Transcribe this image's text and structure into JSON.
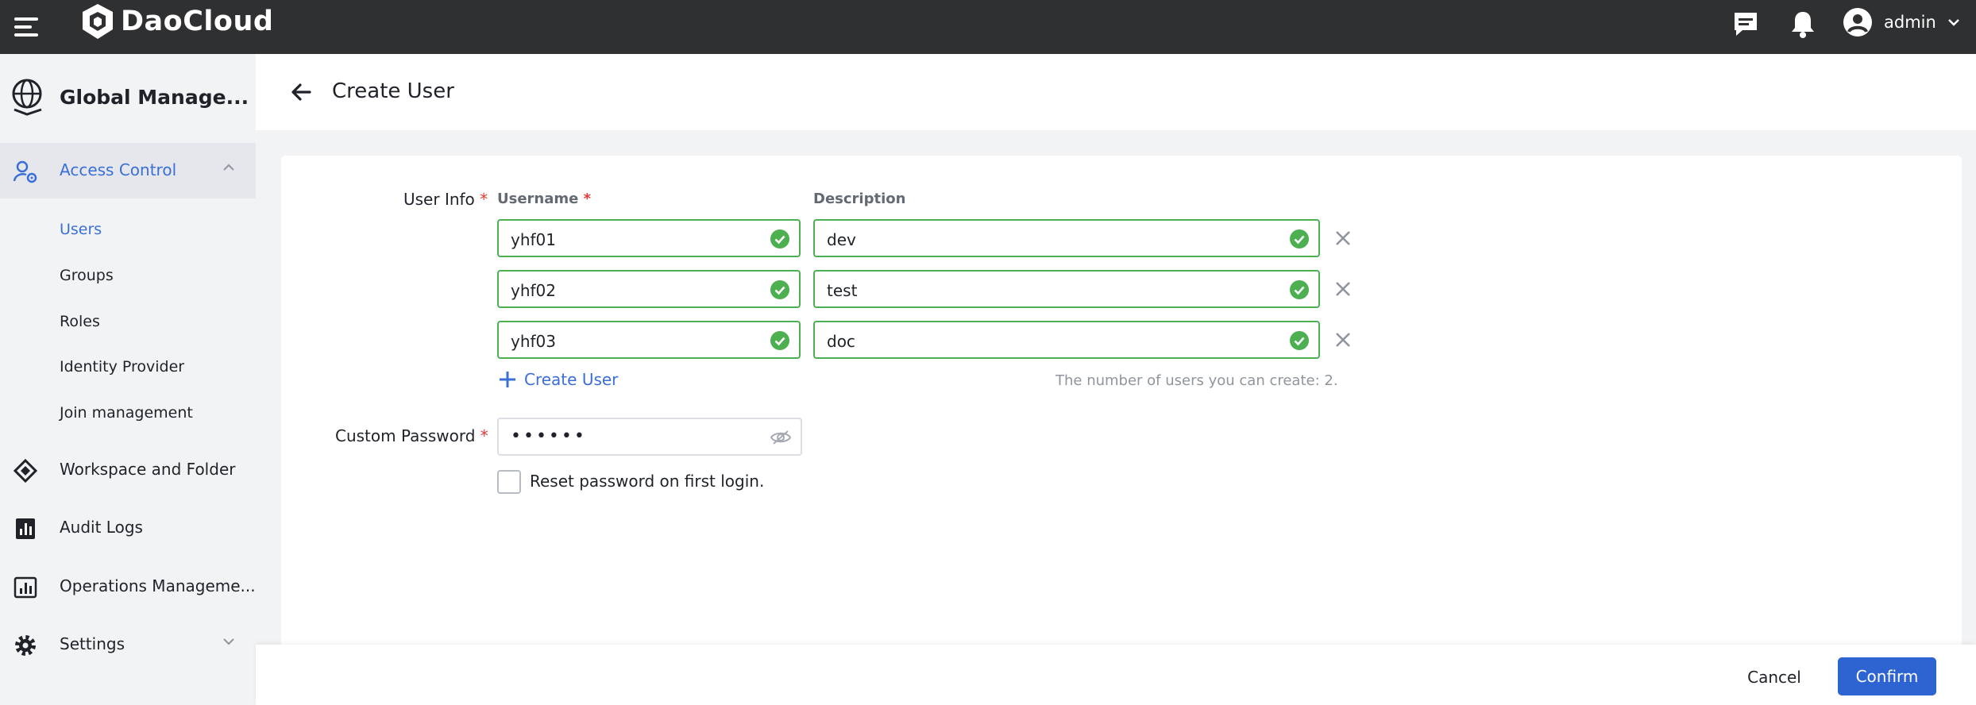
{
  "topbar": {
    "brand": "DaoCloud",
    "user_name": "admin"
  },
  "sidebar": {
    "title": "Global Manage...",
    "groups": [
      {
        "label": "Access Control",
        "icon": "user-gear-icon",
        "expanded": true
      },
      {
        "label": "Workspace and Folder",
        "icon": "workspace-icon"
      },
      {
        "label": "Audit Logs",
        "icon": "audit-chart-icon"
      },
      {
        "label": "Operations Manageme...",
        "icon": "operations-chart-icon"
      },
      {
        "label": "Settings",
        "icon": "gear-icon",
        "expanded": false
      }
    ],
    "sub_items": [
      {
        "label": "Users",
        "active": true
      },
      {
        "label": "Groups"
      },
      {
        "label": "Roles"
      },
      {
        "label": "Identity Provider"
      },
      {
        "label": "Join management"
      }
    ]
  },
  "page": {
    "title": "Create User"
  },
  "form": {
    "user_info_label": "User Info",
    "username_label": "Username",
    "description_label": "Description",
    "required_mark": "*",
    "rows": [
      {
        "username": "yhf01",
        "description": "dev"
      },
      {
        "username": "yhf02",
        "description": "test"
      },
      {
        "username": "yhf03",
        "description": "doc"
      }
    ],
    "add_user_label": "Create User",
    "quota_text": "The number of users you can create: 2.",
    "password_label": "Custom Password",
    "password_value": "••••••",
    "reset_label": "Reset password on first login."
  },
  "footer": {
    "cancel_label": "Cancel",
    "confirm_label": "Confirm"
  },
  "colors": {
    "topbar": "#2f3032",
    "accent": "#3a6fd8",
    "primary_button": "#2d64d2",
    "valid": "#4caf50",
    "required": "#e53935"
  }
}
